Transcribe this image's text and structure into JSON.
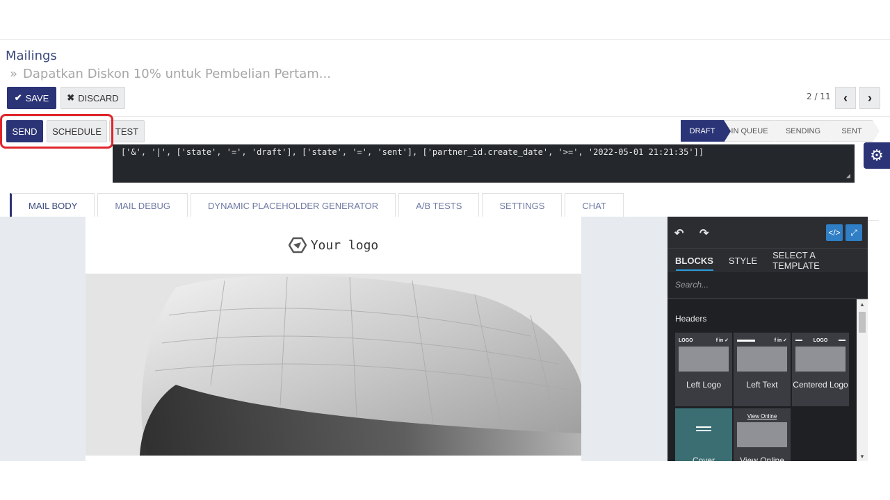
{
  "breadcrumb": {
    "root": "Mailings",
    "separator": "»",
    "current": "Dapatkan Diskon 10% untuk Pembelian Pertam..."
  },
  "toolbar": {
    "save_label": "SAVE",
    "discard_label": "DISCARD"
  },
  "pager": {
    "text": "2 / 11",
    "prev": "‹",
    "next": "›"
  },
  "actions": {
    "send_label": "SEND",
    "schedule_label": "SCHEDULE",
    "test_label": "TEST"
  },
  "statusbar": {
    "stages": [
      "DRAFT",
      "IN QUEUE",
      "SENDING",
      "SENT"
    ],
    "active": "DRAFT"
  },
  "domain_filter": "['&', '|', ['state', '=', 'draft'], ['state', '=', 'sent'], ['partner_id.create_date', '>=', '2022-05-01 21:21:35']]",
  "tabs": [
    "MAIL BODY",
    "MAIL DEBUG",
    "DYNAMIC PLACEHOLDER GENERATOR",
    "A/B TESTS",
    "SETTINGS",
    "CHAT"
  ],
  "active_tab": "MAIL BODY",
  "mail": {
    "logo_text": "Your logo"
  },
  "editor_panel": {
    "tabs": [
      "BLOCKS",
      "STYLE",
      "SELECT A TEMPLATE"
    ],
    "search_placeholder": "Search...",
    "section_heading": "Headers",
    "blocks": [
      {
        "label": "Left Logo",
        "mini_left": "LOGO",
        "mini_right": "f in ✓"
      },
      {
        "label": "Left Text",
        "mini_left": "",
        "mini_right": "f in ✓"
      },
      {
        "label": "Centered Logo",
        "mini_left": "",
        "mini_right": "LOGO"
      },
      {
        "label": "Cover"
      },
      {
        "label": "View Online",
        "mini_link": "View Online"
      }
    ]
  },
  "colors": {
    "primary": "#2b3476",
    "highlight": "#e0242a",
    "panel_bg": "#2b2d31",
    "accent_blue": "#2f7ec6"
  }
}
